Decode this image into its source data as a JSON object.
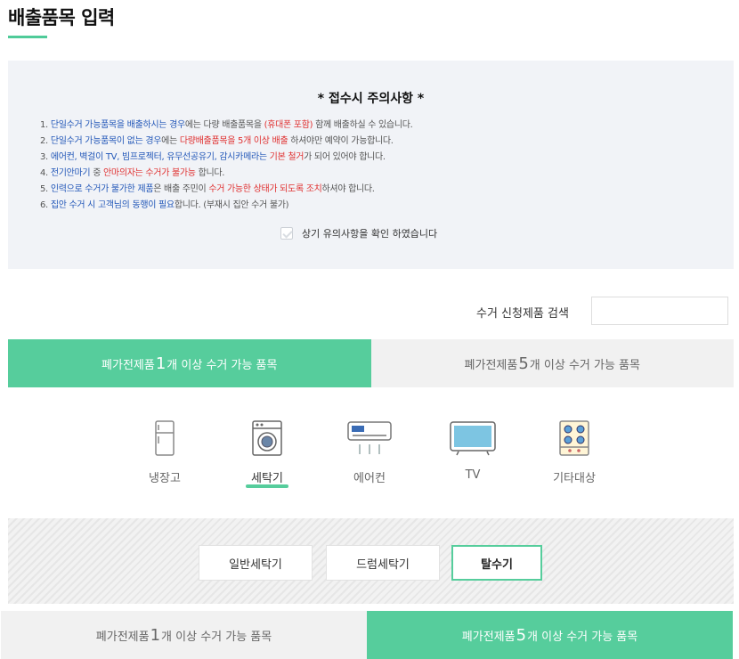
{
  "page": {
    "title": "배출품목 입력"
  },
  "notice": {
    "title": "* 접수시 주의사항 *",
    "items": [
      {
        "a": "1. ",
        "b": "단일수거 가능품목을 배출하시는 경우",
        "c": "에는 다량 배출품목을 ",
        "d": "(휴대폰 포함)",
        "e": " 함께 배출하실 수 있습니다."
      },
      {
        "a": "2. ",
        "b": "단일수거 가능품목이 없는 경우",
        "c": "에는 ",
        "d": "다량배출품목을 5개 이상 배출",
        "e": " 하셔야만 예약이 가능합니다."
      },
      {
        "a": "3. ",
        "b": "에어컨, 벽걸이 TV, 빔프로젝터, 유무선공유기, 감시카메라는 ",
        "c": "",
        "d": "기본 철거",
        "e": "가 되어 있어야 합니다."
      },
      {
        "a": "4. ",
        "b": "전기안마기",
        "c": " 중 ",
        "d": "안마의자는 수거가 불가능",
        "e": " 합니다."
      },
      {
        "a": "5. ",
        "b": "인력으로 수거가 불가한 제품",
        "c": "은 배출 주민이 ",
        "d": "수거 가능한 상태가 되도록 조치",
        "e": "하셔야 합니다."
      },
      {
        "a": "6. ",
        "b": "집안 수거 시 고객님의 동행이 필요",
        "c": "합니다. (부재시 집안 수거 불가)",
        "d": "",
        "e": ""
      }
    ],
    "confirm_label": "상기 유의사항을 확인 하였습니다"
  },
  "search": {
    "label": "수거 신청제품 검색",
    "value": "",
    "placeholder": ""
  },
  "tabs_top": [
    {
      "pre": "폐가전제품 ",
      "num": "1",
      "post": "개 이상 수거 가능 품목",
      "active": true
    },
    {
      "pre": "폐가전제품 ",
      "num": "5",
      "post": "개 이상 수거 가능 품목",
      "active": false
    }
  ],
  "categories": [
    {
      "label": "냉장고",
      "icon": "refrigerator-icon"
    },
    {
      "label": "세탁기",
      "icon": "washing-machine-icon",
      "active": true
    },
    {
      "label": "에어컨",
      "icon": "air-conditioner-icon"
    },
    {
      "label": "TV",
      "icon": "tv-icon"
    },
    {
      "label": "기타대상",
      "icon": "stove-icon"
    }
  ],
  "sub_options": [
    {
      "label": "일반세탁기"
    },
    {
      "label": "드럼세탁기"
    },
    {
      "label": "탈수기",
      "active": true
    }
  ],
  "tabs_bottom": [
    {
      "pre": "폐가전제품 ",
      "num": "1",
      "post": "개 이상 수거 가능 품목",
      "active": false
    },
    {
      "pre": "폐가전제품 ",
      "num": "5",
      "post": "개 이상 수거 가능 품목",
      "active": true
    }
  ],
  "colors": {
    "accent": "#56cd9c",
    "notice_blue": "#2257b8",
    "notice_red": "#e03030"
  }
}
